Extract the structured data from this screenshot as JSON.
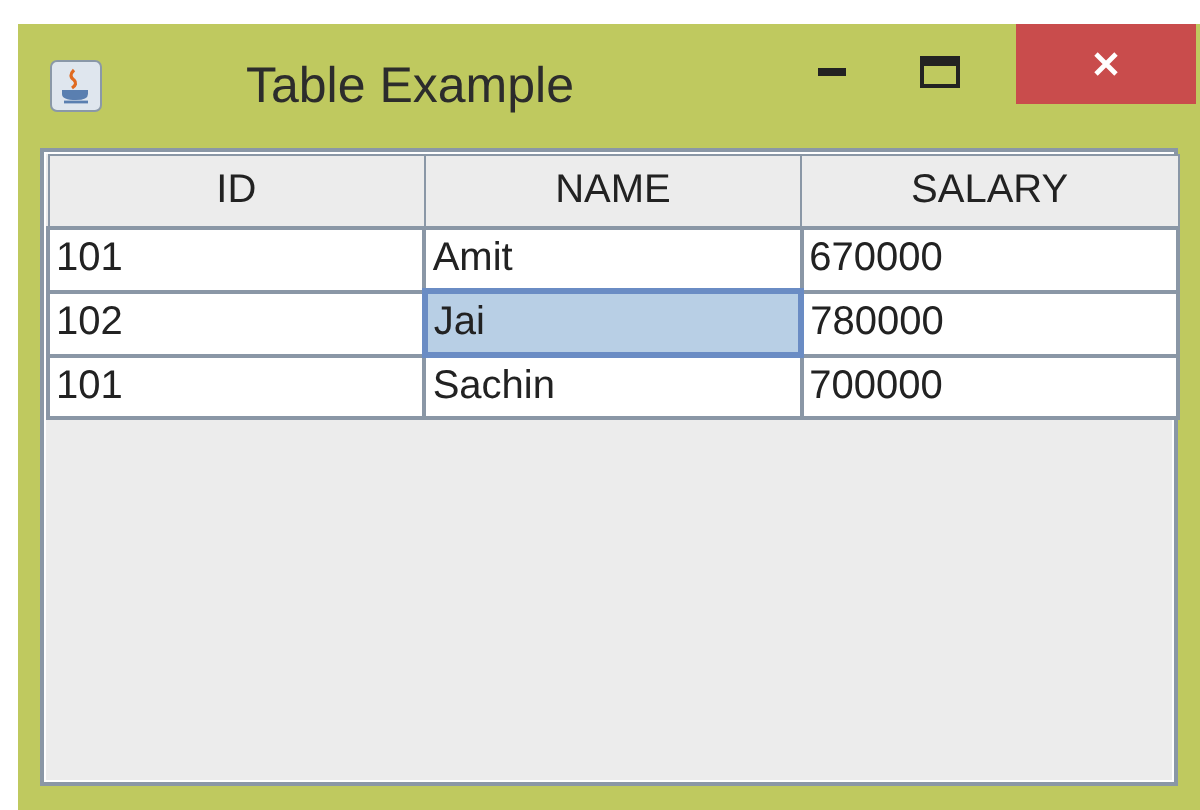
{
  "window": {
    "title": "Table Example"
  },
  "table": {
    "columns": [
      "ID",
      "NAME",
      "SALARY"
    ],
    "rows": [
      {
        "cells": [
          {
            "text": "101",
            "selected": false
          },
          {
            "text": "Amit",
            "selected": false
          },
          {
            "text": "670000",
            "selected": false
          }
        ]
      },
      {
        "cells": [
          {
            "text": "102",
            "selected": false
          },
          {
            "text": "Jai",
            "selected": true
          },
          {
            "text": "780000",
            "selected": false
          }
        ]
      },
      {
        "cells": [
          {
            "text": "101",
            "selected": false
          },
          {
            "text": "Sachin",
            "selected": false
          },
          {
            "text": "700000",
            "selected": false
          }
        ]
      }
    ]
  }
}
